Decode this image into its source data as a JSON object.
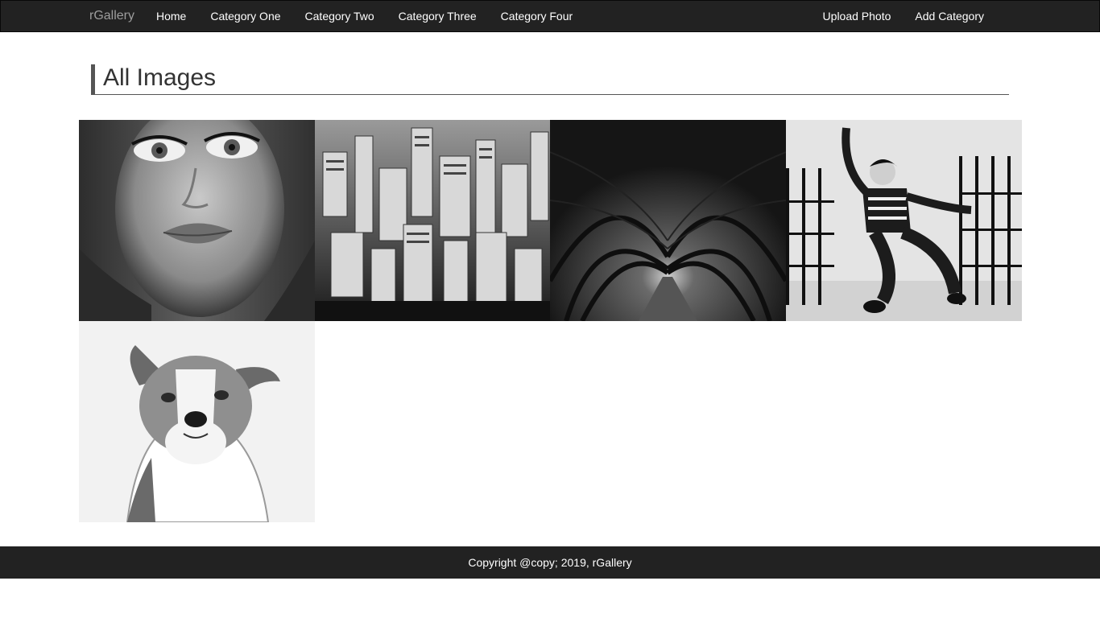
{
  "navbar": {
    "brand": "rGallery",
    "left_links": [
      "Home",
      "Category One",
      "Category Two",
      "Category Three",
      "Category Four"
    ],
    "right_links": [
      "Upload Photo",
      "Add Category"
    ]
  },
  "header": {
    "title": "All Images"
  },
  "footer": {
    "text": "Copyright @copy; 2019, rGallery"
  },
  "colors": {
    "navbar_bg": "#222222",
    "brand": "#9d9d9d",
    "nav_text": "#ffffff",
    "header_border": "#555555"
  }
}
